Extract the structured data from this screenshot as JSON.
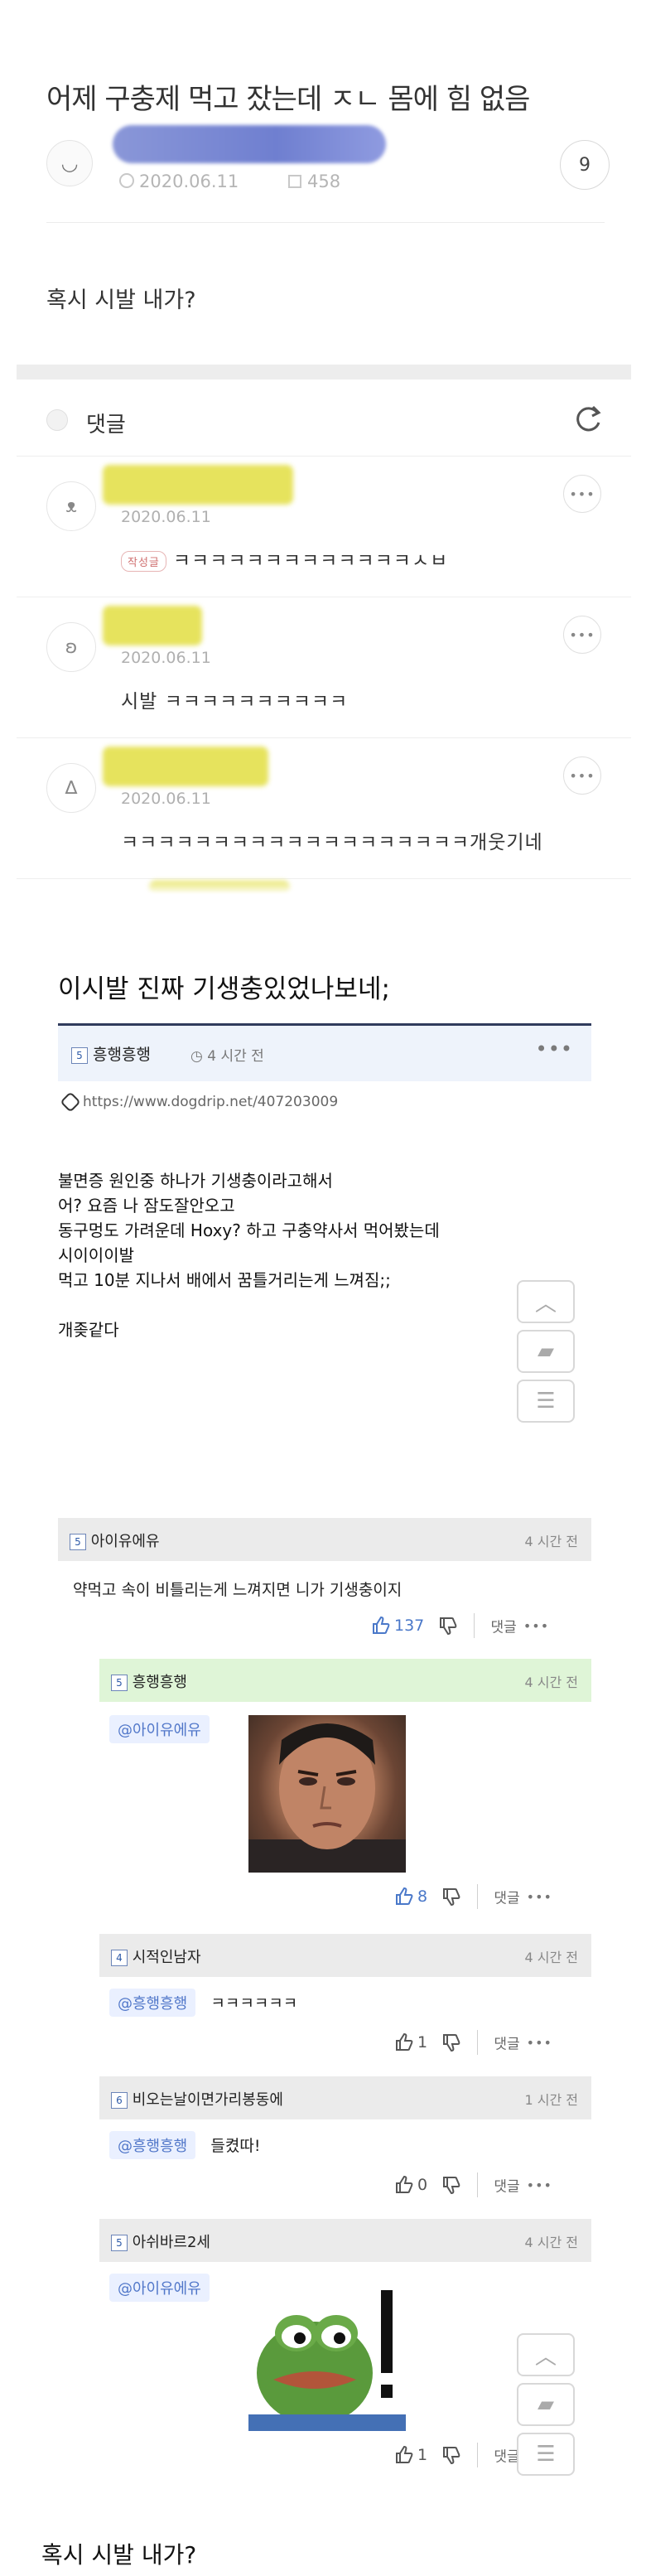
{
  "post": {
    "title": "어제 구충제 먹고 잤는데 ㅈㄴ 몸에 힘 없음",
    "date": "2020.06.11",
    "views": "458",
    "comment_count": "9",
    "body": "혹시 시발 내가?"
  },
  "comments_section": {
    "label": "댓글",
    "items": [
      {
        "date": "2020.06.11",
        "badge": "작성글",
        "text": "ㅋㅋㅋㅋㅋㅋㅋㅋㅋㅋㅋㅋㅋㅅㅂ"
      },
      {
        "date": "2020.06.11",
        "text": "시발 ㅋㅋㅋㅋㅋㅋㅋㅋㅋㅋ"
      },
      {
        "date": "2020.06.11",
        "text": "ㅋㅋㅋㅋㅋㅋㅋㅋㅋㅋㅋㅋㅋㅋㅋㅋㅋㅋㅋ개웃기네"
      }
    ]
  },
  "dogdrip": {
    "title": "이시발 진짜 기생충있었나보네;",
    "author": "흥행흥행",
    "time": "4 시간 전",
    "more": "•••",
    "link": "https://www.dogdrip.net/407203009",
    "body_lines": [
      "불면증 원인중 하나가 기생충이라고해서",
      "어? 요즘 나 잠도잘안오고",
      "동구멍도 가려운데 Hoxy? 하고 구충약사서 먹어봤는데",
      "시이이이발",
      "먹고 10분 지나서 배에서 꿈틀거리는게 느껴짐;;",
      "",
      "개좆같다"
    ],
    "comments": [
      {
        "name": "아이유에유",
        "time": "4 시간 전",
        "text": "약먹고 속이 비틀리는게 느껴지면 니가 기생충이지",
        "up": "137"
      },
      {
        "name": "흥행흥행",
        "time": "4 시간 전",
        "mention": "@아이유에유",
        "up": "8"
      },
      {
        "name": "시적인남자",
        "time": "4 시간 전",
        "mention": "@흥행흥행",
        "text": "ㅋㅋㅋㅋㅋㅋ",
        "up": "1"
      },
      {
        "name": "비오는날이면가리봉동에",
        "time": "1 시간 전",
        "mention": "@흥행흥행",
        "text": "들켰따!",
        "up": "0"
      },
      {
        "name": "아쉬바르2세",
        "time": "4 시간 전",
        "mention": "@아이유에유",
        "up": "1"
      }
    ],
    "reply_label": "댓글",
    "dots": "•••"
  },
  "footer_text": "혹시 시발 내가?"
}
